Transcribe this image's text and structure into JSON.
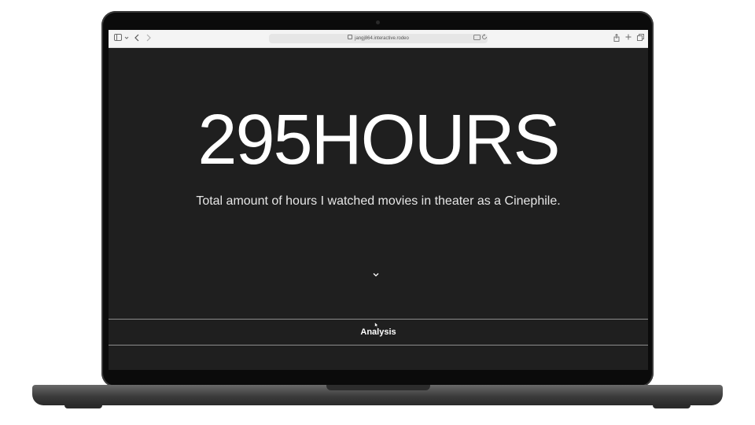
{
  "browser": {
    "url": "jangj864.interactive.rodeo"
  },
  "hero": {
    "title": "295HOURS",
    "subtitle": "Total amount of hours I watched movies in theater as a Cinephile."
  },
  "nav": {
    "label": "Analysis"
  },
  "colors": {
    "page_background": "#1f1f1f",
    "text": "#ffffff",
    "divider": "#8c8c8c"
  },
  "icons": [
    "sidebar-icon",
    "chevron-down-icon",
    "back-icon",
    "forward-icon",
    "lock-icon",
    "translate-icon",
    "reload-icon",
    "share-icon",
    "new-tab-icon",
    "tabs-overview-icon",
    "scroll-down-icon",
    "cursor-icon"
  ]
}
